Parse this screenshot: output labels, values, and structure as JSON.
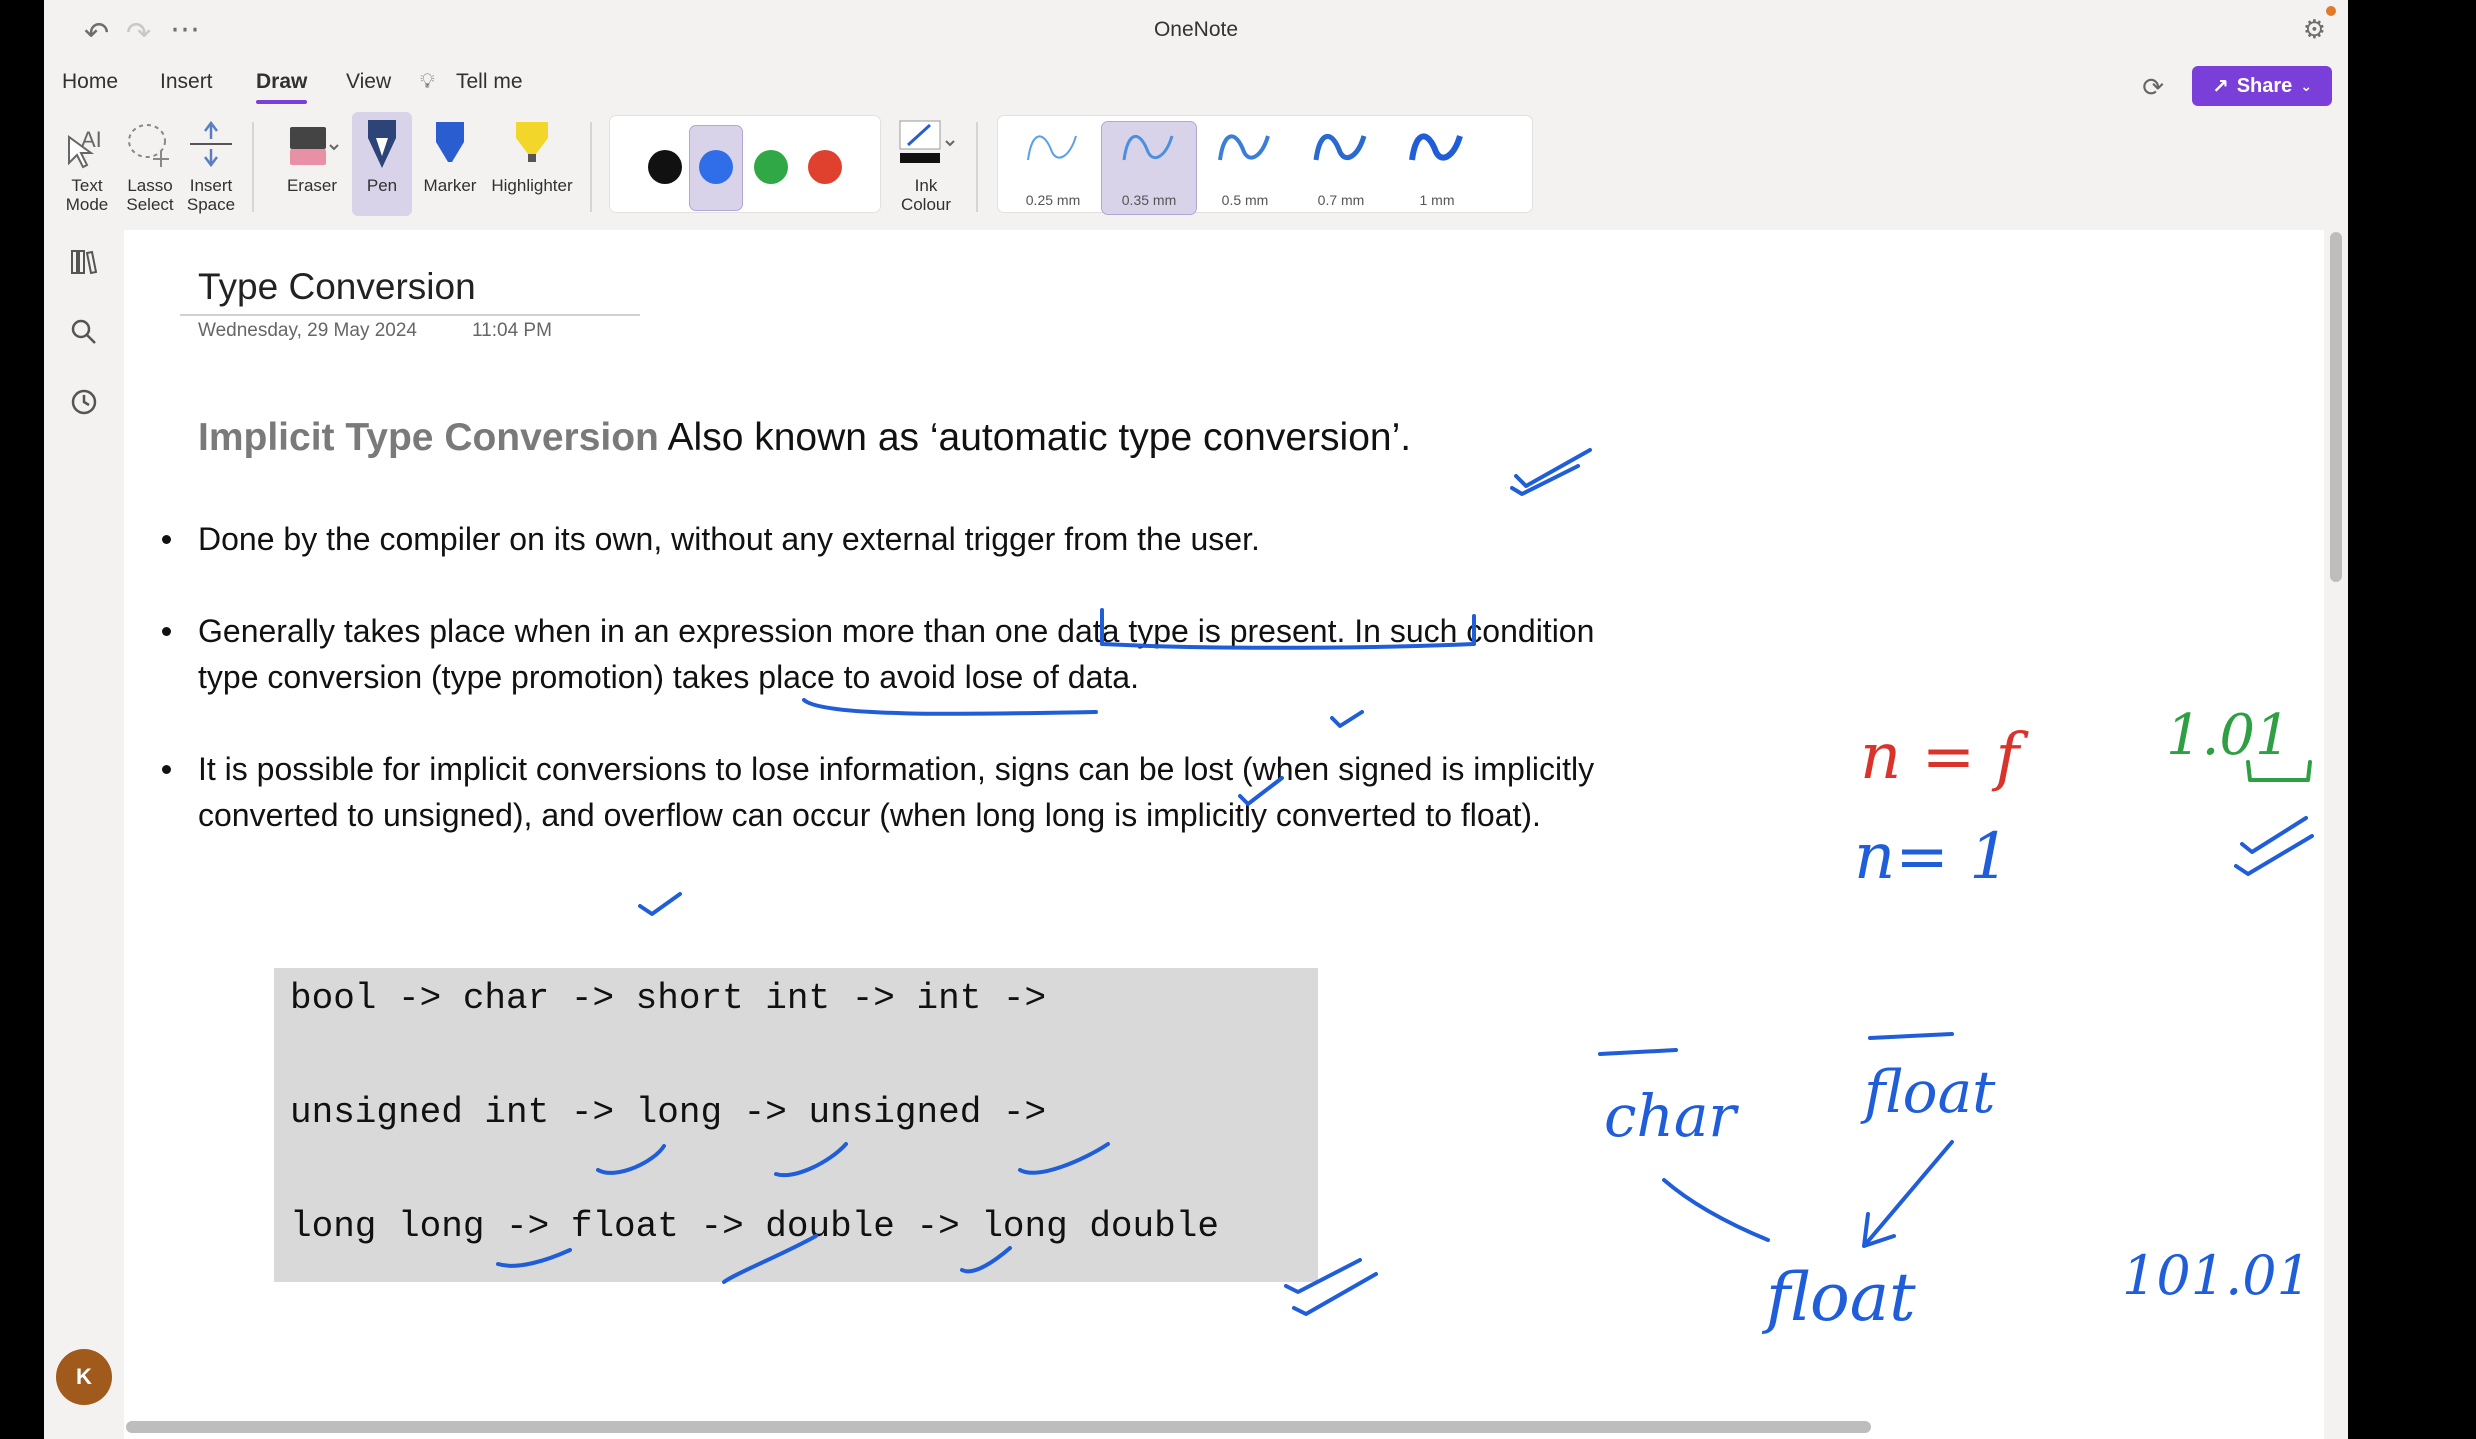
{
  "app": {
    "title": "OneNote"
  },
  "menu": {
    "tabs": [
      "Home",
      "Insert",
      "Draw",
      "View",
      "Tell me"
    ],
    "active": "Draw",
    "share_label": "Share"
  },
  "ribbon": {
    "tools": {
      "text_mode": [
        "Text",
        "Mode"
      ],
      "lasso": [
        "Lasso",
        "Select"
      ],
      "insert_space": [
        "Insert",
        "Space"
      ],
      "eraser": "Eraser",
      "pen": "Pen",
      "marker": "Marker",
      "highlighter": "Highlighter",
      "ink_colour": [
        "Ink",
        "Colour"
      ]
    },
    "colors": [
      "#111111",
      "#2f6ee8",
      "#2fa845",
      "#e0412f"
    ],
    "selected_color": "#2f6ee8",
    "thickness": [
      "0.25 mm",
      "0.35 mm",
      "0.5 mm",
      "0.7 mm",
      "1 mm"
    ],
    "selected_thickness": "0.35 mm"
  },
  "user": {
    "initial": "K"
  },
  "page": {
    "title": "Type Conversion",
    "date": "Wednesday, 29 May 2024",
    "time": "11:04 PM",
    "heading_bold": "Implicit Type Conversion",
    "heading_rest": " Also known as ‘automatic type conversion’.",
    "bullets": [
      "Done by the compiler on its own, without any external trigger from the user.",
      "Generally takes place when in an expression more than one data type is present. In such condition type conversion (type promotion) takes place to avoid lose of data.",
      "It is possible for implicit conversions to lose information, signs can be lost (when signed is implicitly converted to unsigned), and overflow can occur (when long long is implicitly converted to float)."
    ],
    "code_lines": [
      "bool -> char -> short int -> int ->",
      "unsigned int -> long -> unsigned ->",
      "long long -> float -> double -> long double"
    ]
  },
  "handwriting": {
    "red": "n = f",
    "green": "1.01",
    "blue_line": "n= 1",
    "char": "char",
    "float_top": "float",
    "float_bottom": "float",
    "number": "101.01"
  },
  "ink_colors": {
    "blue": "#1f5ed8",
    "red": "#d9342b",
    "green": "#2ea043"
  }
}
